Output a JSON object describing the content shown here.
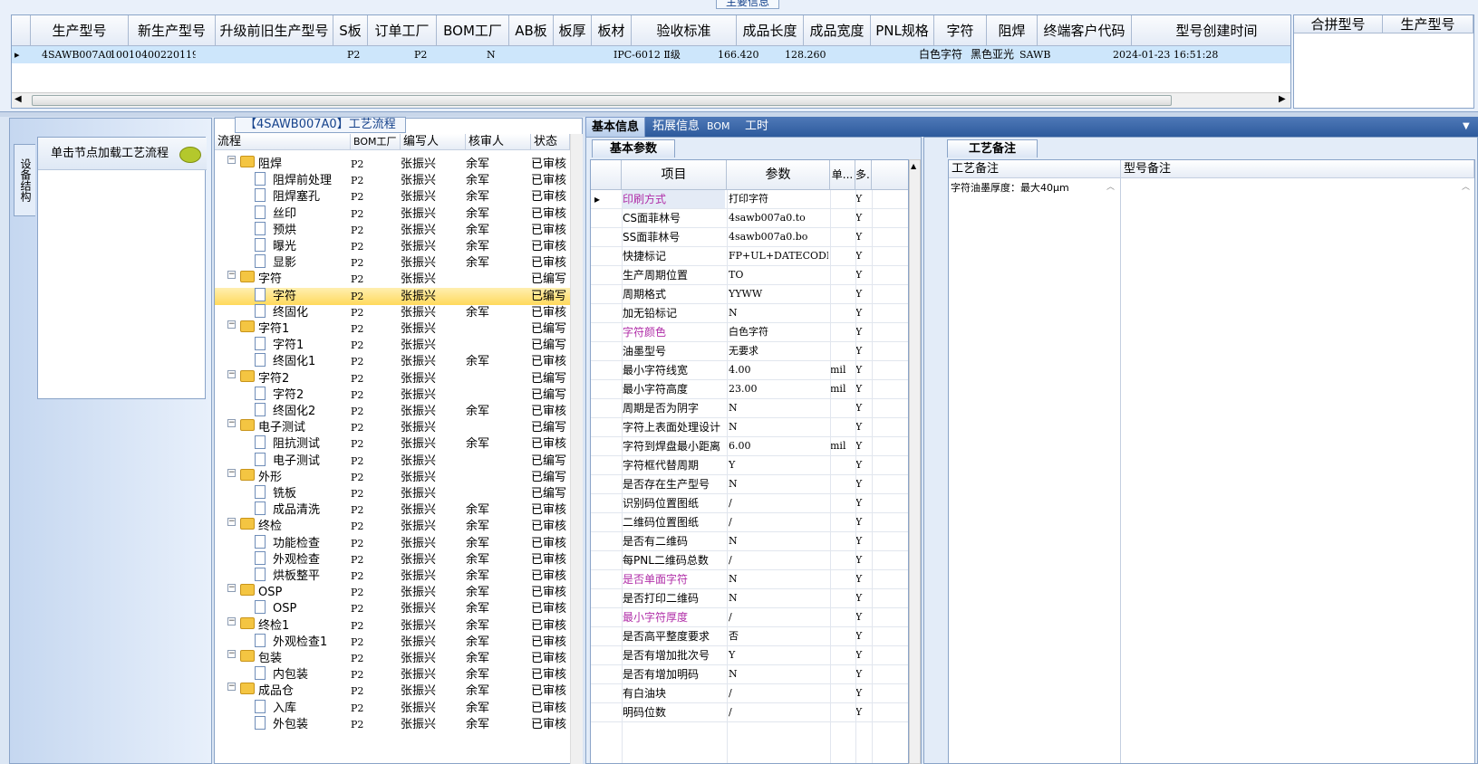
{
  "top": {
    "title": "主要信息",
    "columns": [
      "生产型号",
      "新生产型号",
      "升级前旧生产型号",
      "S板",
      "订单工厂",
      "BOM工厂",
      "AB板",
      "板厚",
      "板材",
      "验收标准",
      "成品长度",
      "成品宽度",
      "PNL规格",
      "字符",
      "阻焊",
      "终端客户代码",
      "型号创建时间"
    ],
    "row": {
      "model": "4SAWB007A0",
      "new_model": "10010400220119",
      "order_factory": "P2",
      "bom_factory": "P2",
      "ab": "N",
      "standard": "IPC-6012 Ⅱ级",
      "length": "166.420",
      "width": "128.260",
      "char": "白色字符",
      "mask": "黑色亚光",
      "customer": "SAWB",
      "created": "2024-01-23 16:51:28"
    },
    "merge_columns": [
      "合拼型号",
      "生产型号"
    ]
  },
  "leftnav": {
    "vtab": "设备结构",
    "header": "单击节点加载工艺流程"
  },
  "tree": {
    "title": "【4SAWB007A0】工艺流程",
    "columns": [
      "流程",
      "BOM工厂",
      "编写人",
      "核审人",
      "状态"
    ],
    "rows": [
      {
        "name": "阻焊",
        "level": 0,
        "folder": true,
        "f": "P2",
        "w": "张振兴",
        "r": "余军",
        "s": "已审核"
      },
      {
        "name": "阻焊前处理",
        "level": 1,
        "folder": false,
        "f": "P2",
        "w": "张振兴",
        "r": "余军",
        "s": "已审核"
      },
      {
        "name": "阻焊塞孔",
        "level": 1,
        "folder": false,
        "f": "P2",
        "w": "张振兴",
        "r": "余军",
        "s": "已审核"
      },
      {
        "name": "丝印",
        "level": 1,
        "folder": false,
        "f": "P2",
        "w": "张振兴",
        "r": "余军",
        "s": "已审核"
      },
      {
        "name": "预烘",
        "level": 1,
        "folder": false,
        "f": "P2",
        "w": "张振兴",
        "r": "余军",
        "s": "已审核"
      },
      {
        "name": "曝光",
        "level": 1,
        "folder": false,
        "f": "P2",
        "w": "张振兴",
        "r": "余军",
        "s": "已审核"
      },
      {
        "name": "显影",
        "level": 1,
        "folder": false,
        "f": "P2",
        "w": "张振兴",
        "r": "余军",
        "s": "已审核"
      },
      {
        "name": "字符",
        "level": 0,
        "folder": true,
        "f": "P2",
        "w": "张振兴",
        "r": "",
        "s": "已编写"
      },
      {
        "name": "字符",
        "level": 1,
        "folder": false,
        "f": "P2",
        "w": "张振兴",
        "r": "",
        "s": "已编写",
        "hl": true
      },
      {
        "name": "终固化",
        "level": 1,
        "folder": false,
        "f": "P2",
        "w": "张振兴",
        "r": "余军",
        "s": "已审核"
      },
      {
        "name": "字符1",
        "level": 0,
        "folder": true,
        "f": "P2",
        "w": "张振兴",
        "r": "",
        "s": "已编写"
      },
      {
        "name": "字符1",
        "level": 1,
        "folder": false,
        "f": "P2",
        "w": "张振兴",
        "r": "",
        "s": "已编写"
      },
      {
        "name": "终固化1",
        "level": 1,
        "folder": false,
        "f": "P2",
        "w": "张振兴",
        "r": "余军",
        "s": "已审核"
      },
      {
        "name": "字符2",
        "level": 0,
        "folder": true,
        "f": "P2",
        "w": "张振兴",
        "r": "",
        "s": "已编写"
      },
      {
        "name": "字符2",
        "level": 1,
        "folder": false,
        "f": "P2",
        "w": "张振兴",
        "r": "",
        "s": "已编写"
      },
      {
        "name": "终固化2",
        "level": 1,
        "folder": false,
        "f": "P2",
        "w": "张振兴",
        "r": "余军",
        "s": "已审核"
      },
      {
        "name": "电子测试",
        "level": 0,
        "folder": true,
        "f": "P2",
        "w": "张振兴",
        "r": "",
        "s": "已编写"
      },
      {
        "name": "阻抗测试",
        "level": 1,
        "folder": false,
        "f": "P2",
        "w": "张振兴",
        "r": "余军",
        "s": "已审核"
      },
      {
        "name": "电子测试",
        "level": 1,
        "folder": false,
        "f": "P2",
        "w": "张振兴",
        "r": "",
        "s": "已编写"
      },
      {
        "name": "外形",
        "level": 0,
        "folder": true,
        "f": "P2",
        "w": "张振兴",
        "r": "",
        "s": "已编写"
      },
      {
        "name": "铣板",
        "level": 1,
        "folder": false,
        "f": "P2",
        "w": "张振兴",
        "r": "",
        "s": "已编写"
      },
      {
        "name": "成品清洗",
        "level": 1,
        "folder": false,
        "f": "P2",
        "w": "张振兴",
        "r": "余军",
        "s": "已审核"
      },
      {
        "name": "终检",
        "level": 0,
        "folder": true,
        "f": "P2",
        "w": "张振兴",
        "r": "余军",
        "s": "已审核"
      },
      {
        "name": "功能检查",
        "level": 1,
        "folder": false,
        "f": "P2",
        "w": "张振兴",
        "r": "余军",
        "s": "已审核"
      },
      {
        "name": "外观检查",
        "level": 1,
        "folder": false,
        "f": "P2",
        "w": "张振兴",
        "r": "余军",
        "s": "已审核"
      },
      {
        "name": "烘板整平",
        "level": 1,
        "folder": false,
        "f": "P2",
        "w": "张振兴",
        "r": "余军",
        "s": "已审核"
      },
      {
        "name": "OSP",
        "level": 0,
        "folder": true,
        "f": "P2",
        "w": "张振兴",
        "r": "余军",
        "s": "已审核"
      },
      {
        "name": "OSP",
        "level": 1,
        "folder": false,
        "f": "P2",
        "w": "张振兴",
        "r": "余军",
        "s": "已审核"
      },
      {
        "name": "终检1",
        "level": 0,
        "folder": true,
        "f": "P2",
        "w": "张振兴",
        "r": "余军",
        "s": "已审核"
      },
      {
        "name": "外观检查1",
        "level": 1,
        "folder": false,
        "f": "P2",
        "w": "张振兴",
        "r": "余军",
        "s": "已审核"
      },
      {
        "name": "包装",
        "level": 0,
        "folder": true,
        "f": "P2",
        "w": "张振兴",
        "r": "余军",
        "s": "已审核"
      },
      {
        "name": "内包装",
        "level": 1,
        "folder": false,
        "f": "P2",
        "w": "张振兴",
        "r": "余军",
        "s": "已审核"
      },
      {
        "name": "成品仓",
        "level": 0,
        "folder": true,
        "f": "P2",
        "w": "张振兴",
        "r": "余军",
        "s": "已审核"
      },
      {
        "name": "入库",
        "level": 1,
        "folder": false,
        "f": "P2",
        "w": "张振兴",
        "r": "余军",
        "s": "已审核"
      },
      {
        "name": "外包装",
        "level": 1,
        "folder": false,
        "f": "P2",
        "w": "张振兴",
        "r": "余军",
        "s": "已审核"
      }
    ]
  },
  "tabs": [
    "基本信息",
    "拓展信息",
    "BOM",
    "工时"
  ],
  "params": {
    "tab": "基本参数",
    "columns": [
      "项目",
      "参数",
      "单...",
      "多..."
    ],
    "highlight_color": "#b02ea8",
    "rows": [
      {
        "n": "印刷方式",
        "v": "打印字符",
        "u": "",
        "c": "Y",
        "hl": true,
        "sel": true
      },
      {
        "n": "CS面菲林号",
        "v": "4sawb007a0.to",
        "u": "",
        "c": "Y"
      },
      {
        "n": "SS面菲林号",
        "v": "4sawb007a0.bo",
        "u": "",
        "c": "Y"
      },
      {
        "n": "快捷标记",
        "v": "FP+UL+DATECODE",
        "u": "",
        "c": "Y"
      },
      {
        "n": "生产周期位置",
        "v": "TO",
        "u": "",
        "c": "Y"
      },
      {
        "n": "周期格式",
        "v": "YYWW",
        "u": "",
        "c": "Y"
      },
      {
        "n": "加无铅标记",
        "v": "N",
        "u": "",
        "c": "Y"
      },
      {
        "n": "字符颜色",
        "v": "白色字符",
        "u": "",
        "c": "Y",
        "hl": true
      },
      {
        "n": "油墨型号",
        "v": "无要求",
        "u": "",
        "c": "Y"
      },
      {
        "n": "最小字符线宽",
        "v": "4.00",
        "u": "mil",
        "c": "Y"
      },
      {
        "n": "最小字符高度",
        "v": "23.00",
        "u": "mil",
        "c": "Y"
      },
      {
        "n": "周期是否为阴字",
        "v": "N",
        "u": "",
        "c": "Y"
      },
      {
        "n": "字符上表面处理设计",
        "v": "N",
        "u": "",
        "c": "Y"
      },
      {
        "n": "字符到焊盘最小距离",
        "v": "6.00",
        "u": "mil",
        "c": "Y"
      },
      {
        "n": "字符框代替周期",
        "v": "Y",
        "u": "",
        "c": "Y"
      },
      {
        "n": "是否存在生产型号",
        "v": "N",
        "u": "",
        "c": "Y"
      },
      {
        "n": "识别码位置图纸",
        "v": "/",
        "u": "",
        "c": "Y"
      },
      {
        "n": "二维码位置图纸",
        "v": "/",
        "u": "",
        "c": "Y"
      },
      {
        "n": "是否有二维码",
        "v": "N",
        "u": "",
        "c": "Y"
      },
      {
        "n": "每PNL二维码总数",
        "v": "/",
        "u": "",
        "c": "Y"
      },
      {
        "n": "是否单面字符",
        "v": "N",
        "u": "",
        "c": "Y",
        "hl": true
      },
      {
        "n": "是否打印二维码",
        "v": "N",
        "u": "",
        "c": "Y"
      },
      {
        "n": "最小字符厚度",
        "v": "/",
        "u": "",
        "c": "Y",
        "hl": true
      },
      {
        "n": "是否高平整度要求",
        "v": "否",
        "u": "",
        "c": "Y"
      },
      {
        "n": "是否有增加批次号",
        "v": "Y",
        "u": "",
        "c": "Y"
      },
      {
        "n": "是否有增加明码",
        "v": "N",
        "u": "",
        "c": "Y"
      },
      {
        "n": "有白油块",
        "v": "/",
        "u": "",
        "c": "Y"
      },
      {
        "n": "明码位数",
        "v": "/",
        "u": "",
        "c": "Y"
      }
    ]
  },
  "notes": {
    "tab": "工艺备注",
    "col1": "工艺备注",
    "col2": "型号备注",
    "text": "字符油墨厚度：最大40μm"
  }
}
